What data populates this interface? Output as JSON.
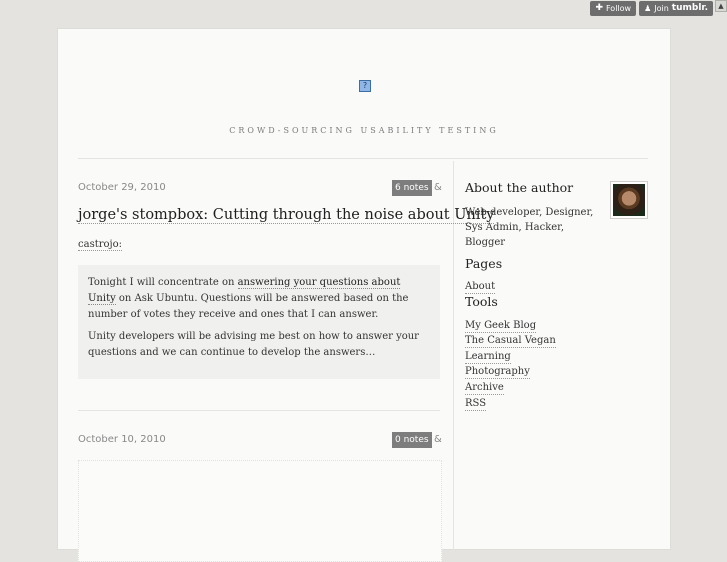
{
  "tumblr_controls": {
    "follow_label": "Follow",
    "join_label": "Join",
    "brand": "tumblr."
  },
  "header": {
    "tagline": "CROWD-SOURCING USABILITY TESTING"
  },
  "posts": [
    {
      "date": "October 29, 2010",
      "notes": "6 notes",
      "amp": "&",
      "title": "jorge's stompbox: Cutting through the noise about Unity",
      "source": "castrojo:",
      "quote": {
        "p1_before": "Tonight I will concentrate on ",
        "p1_link": "answering your questions about Unity",
        "p1_after": " on Ask Ubuntu. Questions will be answered based on the number of votes they receive and ones that I can answer.",
        "p2": "Unity developers will be advising me best on how to answer your questions and we can continue to develop the answers…"
      }
    },
    {
      "date": "October 10, 2010",
      "notes": "0 notes",
      "amp": "&"
    }
  ],
  "sidebar": {
    "about_heading": "About the author",
    "about_text": "Web developer, Designer, Sys Admin, Hacker, Blogger",
    "pages_heading": "Pages",
    "pages": [
      "About"
    ],
    "tools_heading": "Tools",
    "tools": [
      "My Geek Blog",
      "The Casual Vegan",
      "Learning",
      "Photography",
      "Archive",
      "RSS"
    ]
  }
}
